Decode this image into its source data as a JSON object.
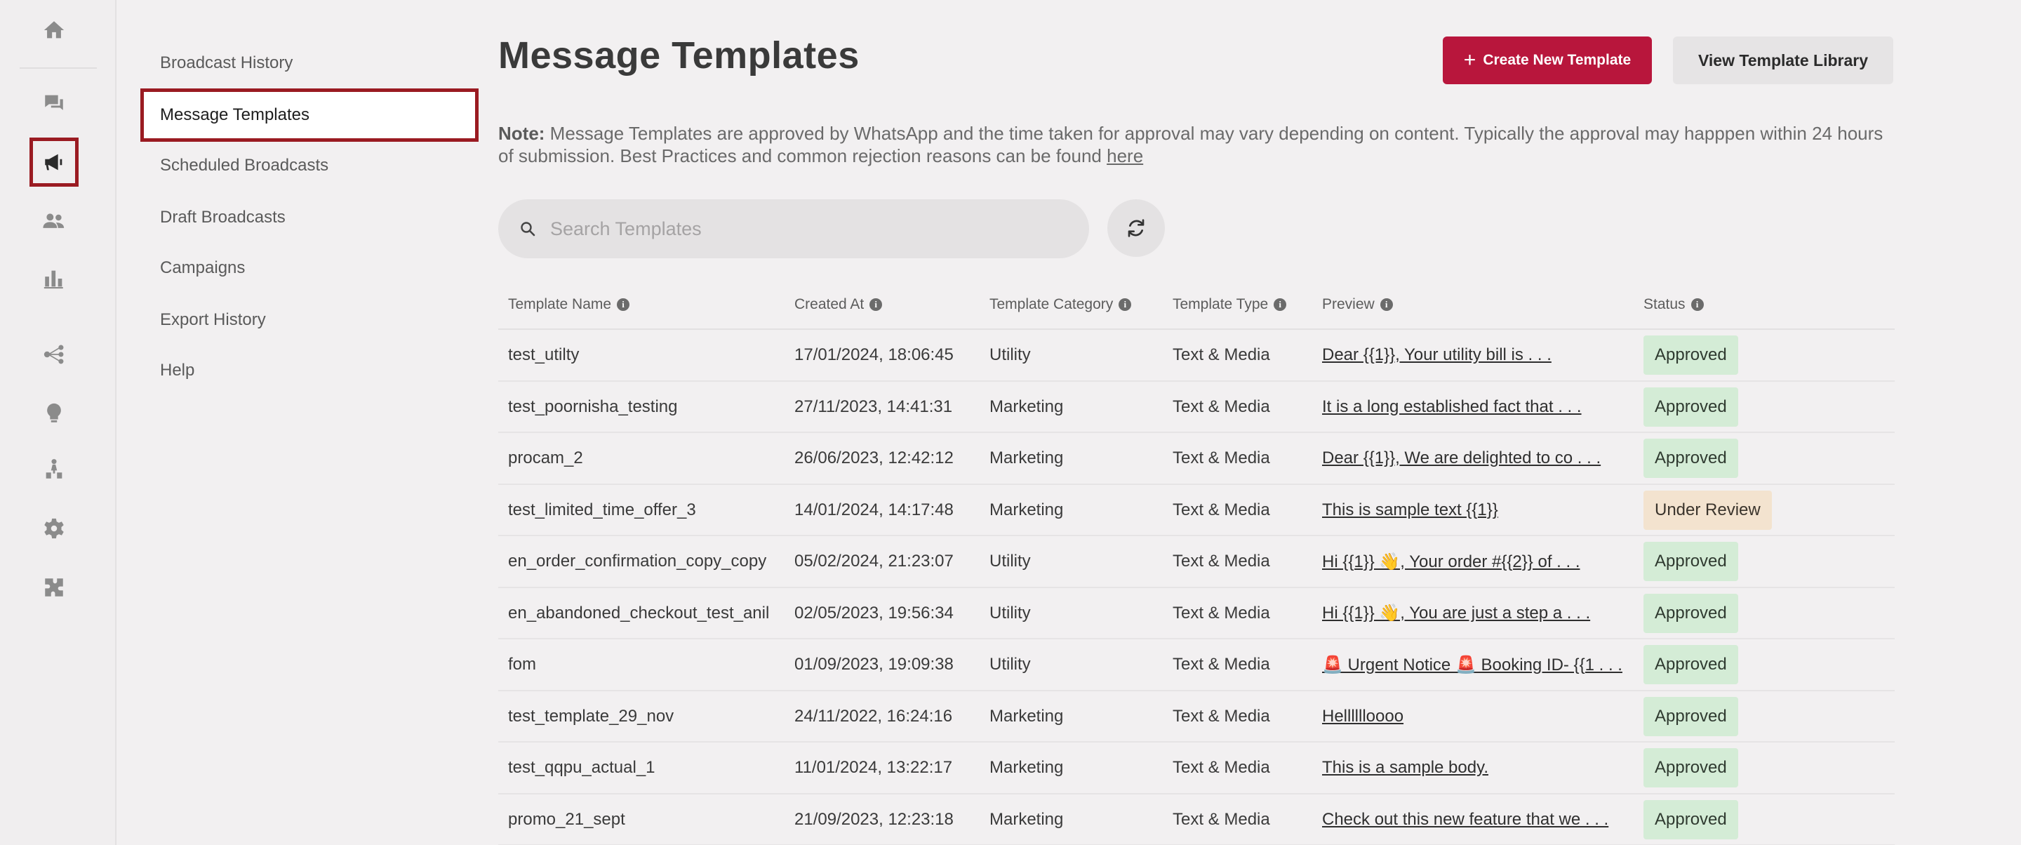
{
  "sidebar": {
    "icons": [
      "home-icon",
      "chat-icon",
      "megaphone-icon",
      "users-icon",
      "bar-chart-icon",
      "flow-icon",
      "lightbulb-icon",
      "hierarchy-icon",
      "gear-icon",
      "puzzle-icon"
    ],
    "active_icon": "megaphone-icon"
  },
  "subnav": {
    "items": [
      {
        "label": "Broadcast History"
      },
      {
        "label": "Message Templates"
      },
      {
        "label": "Scheduled Broadcasts"
      },
      {
        "label": "Draft Broadcasts"
      },
      {
        "label": "Campaigns"
      },
      {
        "label": "Export History"
      },
      {
        "label": "Help"
      }
    ],
    "active": "Message Templates"
  },
  "header": {
    "title": "Message Templates",
    "create_label": "Create New Template",
    "library_label": "View Template Library"
  },
  "note": {
    "prefix": "Note:",
    "text": " Message Templates are approved by WhatsApp and the time taken for approval may vary depending on content. Typically the approval may happpen within 24 hours of submission. Best Practices and common rejection reasons can be found ",
    "link": "here"
  },
  "search": {
    "placeholder": "Search Templates",
    "value": ""
  },
  "table": {
    "columns": [
      "Template Name",
      "Created At",
      "Template Category",
      "Template Type",
      "Preview",
      "Status"
    ],
    "rows": [
      {
        "name": "test_utilty",
        "created": "17/01/2024, 18:06:45",
        "category": "Utility",
        "type": "Text & Media",
        "preview": "Dear {{1}}, Your utility bill is . . .",
        "status": "Approved"
      },
      {
        "name": "test_poornisha_testing",
        "created": "27/11/2023, 14:41:31",
        "category": "Marketing",
        "type": "Text & Media",
        "preview": "It is a long established fact that . . .",
        "status": "Approved"
      },
      {
        "name": "procam_2",
        "created": "26/06/2023, 12:42:12",
        "category": "Marketing",
        "type": "Text & Media",
        "preview": "Dear {{1}}, We are delighted to co . . .",
        "status": "Approved"
      },
      {
        "name": "test_limited_time_offer_3",
        "created": "14/01/2024, 14:17:48",
        "category": "Marketing",
        "type": "Text & Media",
        "preview": "This is sample text {{1}}",
        "status": "Under Review"
      },
      {
        "name": "en_order_confirmation_copy_copy",
        "created": "05/02/2024, 21:23:07",
        "category": "Utility",
        "type": "Text & Media",
        "preview": "Hi {{1}} 👋, Your order #{{2}} of . . .",
        "status": "Approved"
      },
      {
        "name": "en_abandoned_checkout_test_anil",
        "created": "02/05/2023, 19:56:34",
        "category": "Utility",
        "type": "Text & Media",
        "preview": "Hi {{1}} 👋, You are just a step a . . .",
        "status": "Approved"
      },
      {
        "name": "fom",
        "created": "01/09/2023, 19:09:38",
        "category": "Utility",
        "type": "Text & Media",
        "preview": "🚨 Urgent Notice 🚨 Booking ID- {{1 . . .",
        "status": "Approved"
      },
      {
        "name": "test_template_29_nov",
        "created": "24/11/2022, 16:24:16",
        "category": "Marketing",
        "type": "Text & Media",
        "preview": "Helllllloooo",
        "status": "Approved"
      },
      {
        "name": "test_qqpu_actual_1",
        "created": "11/01/2024, 13:22:17",
        "category": "Marketing",
        "type": "Text & Media",
        "preview": "This is a sample body.",
        "status": "Approved"
      },
      {
        "name": "promo_21_sept",
        "created": "21/09/2023, 12:23:18",
        "category": "Marketing",
        "type": "Text & Media",
        "preview": "Check out this new feature that we . . .",
        "status": "Approved"
      }
    ]
  },
  "colors": {
    "accent": "#b8163c",
    "active_outline": "#9a1b22",
    "approved_bg": "#d4ecd6",
    "review_bg": "#f3e3cf"
  }
}
